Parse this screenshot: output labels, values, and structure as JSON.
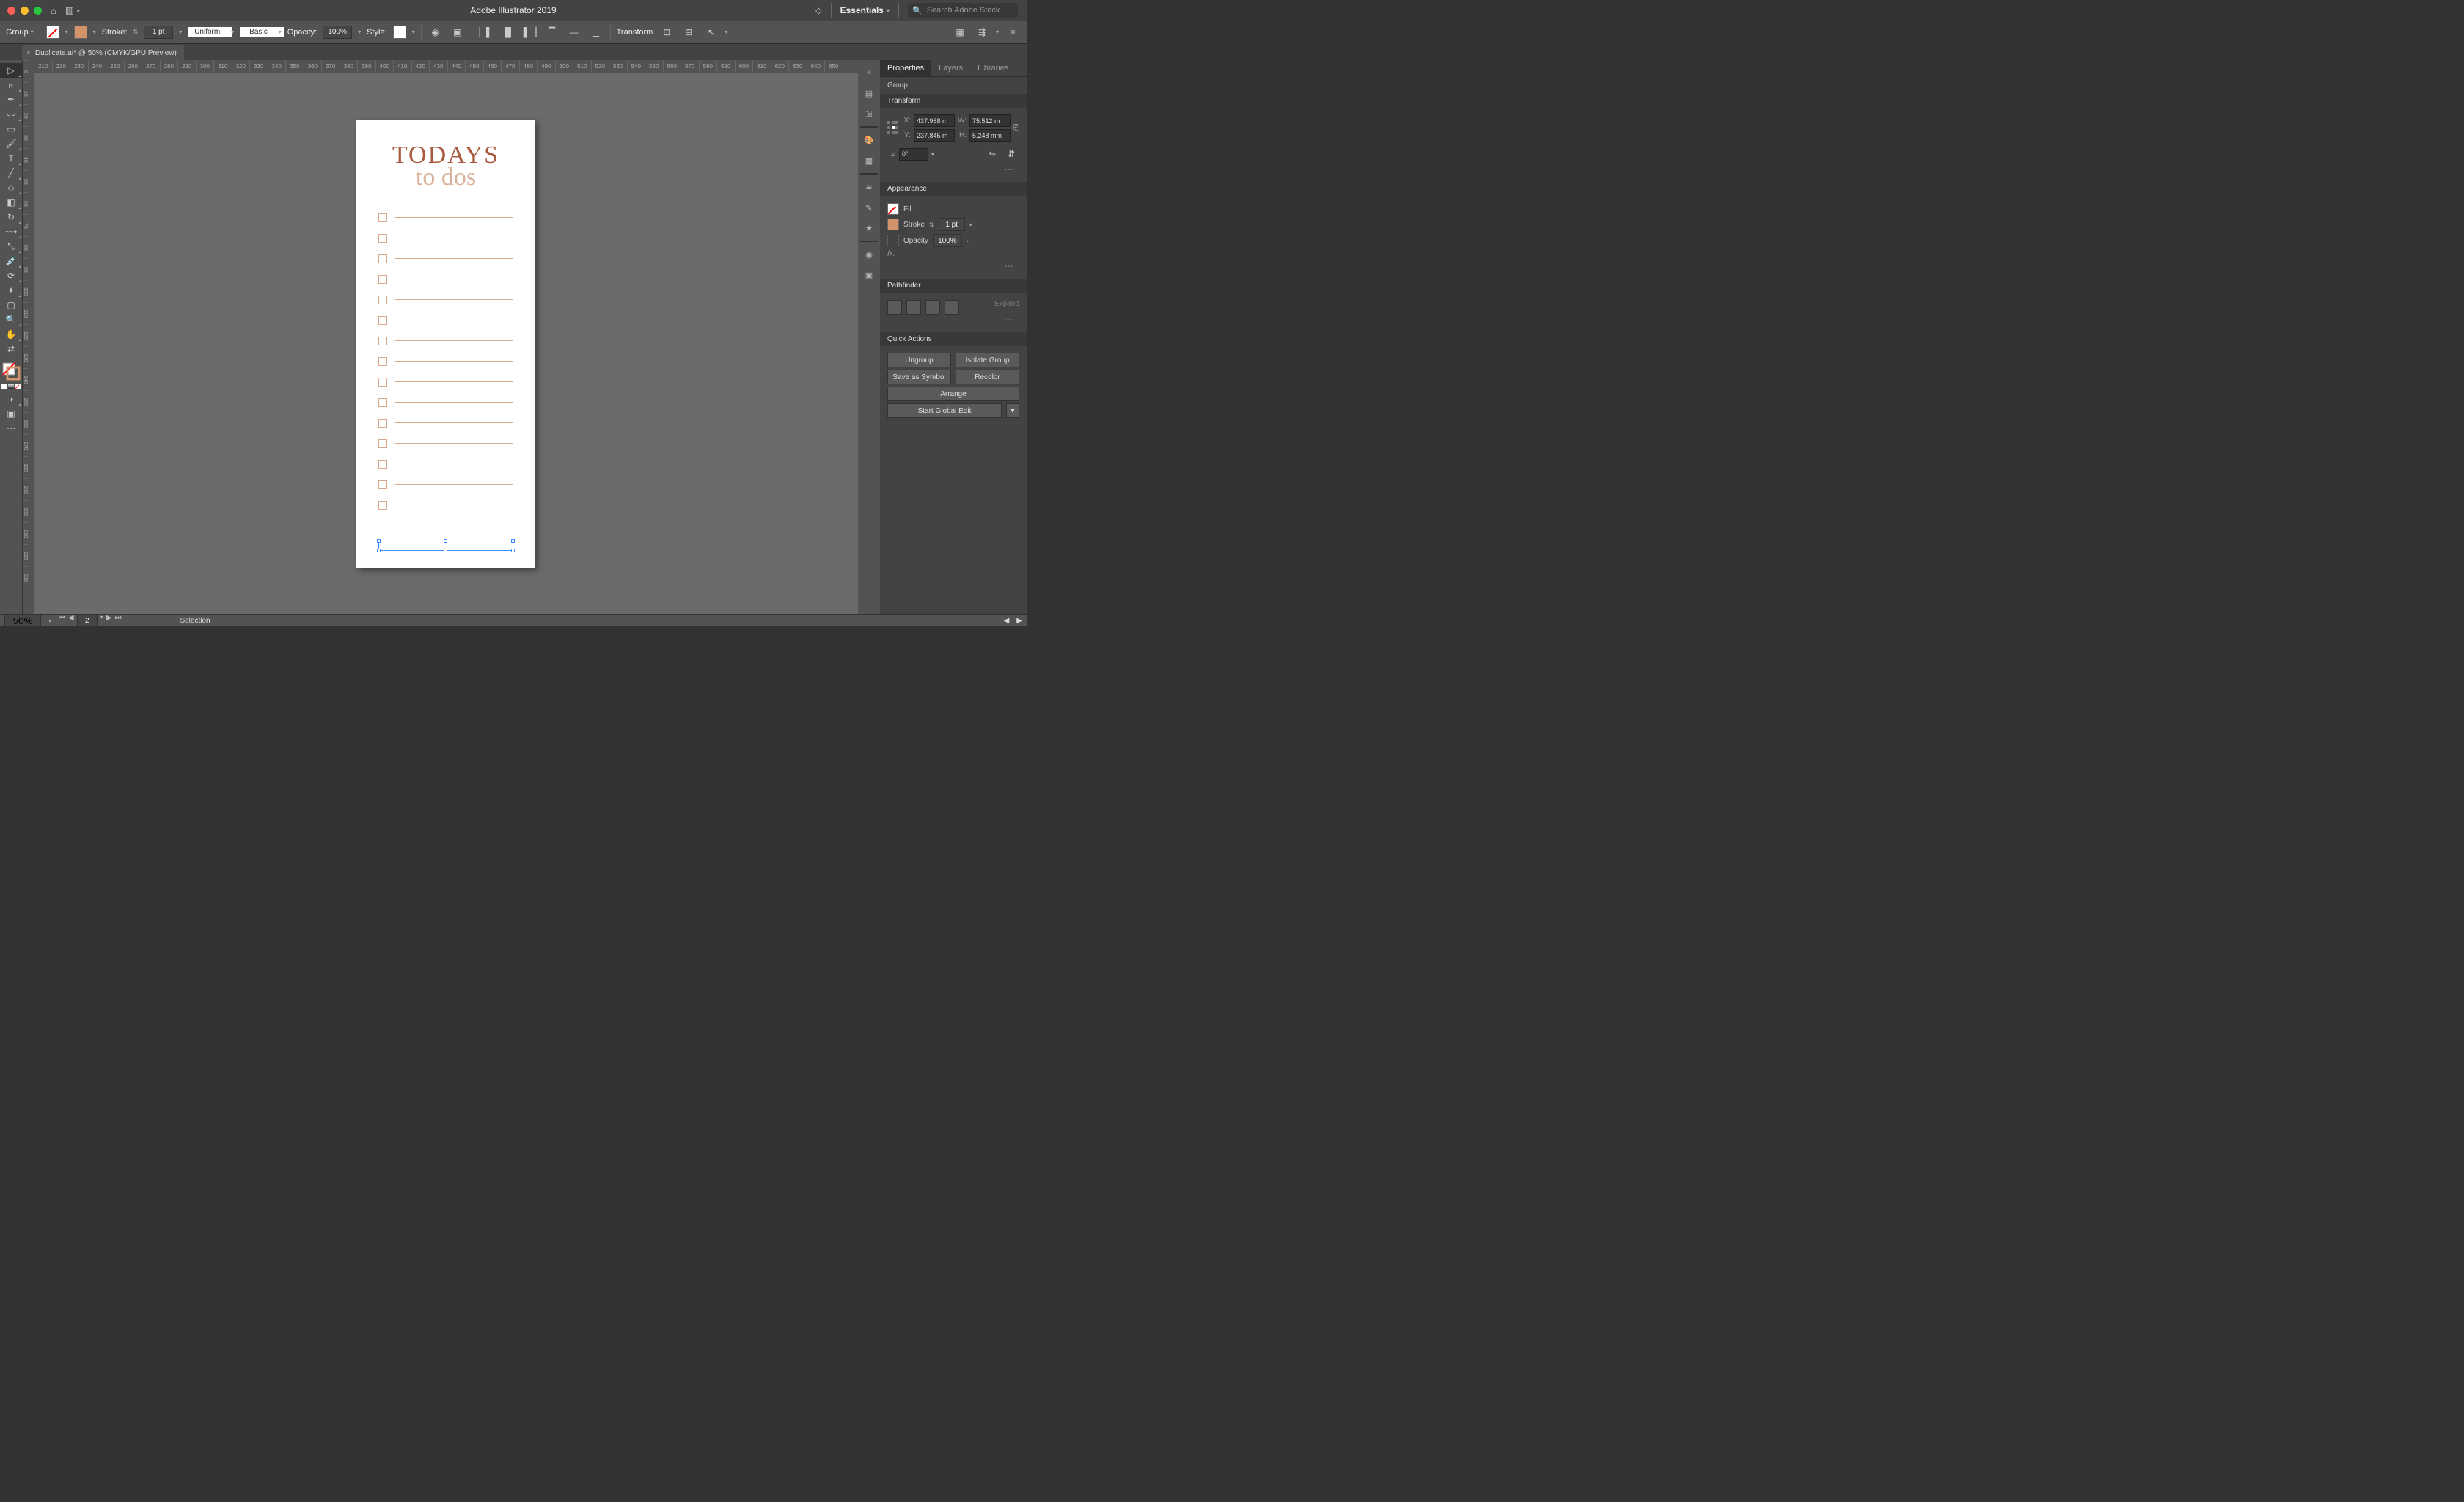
{
  "titlebar": {
    "title": "Adobe Illustrator 2019",
    "workspace": "Essentials",
    "stock_placeholder": "Search Adobe Stock"
  },
  "control": {
    "selection_label": "Group",
    "stroke_label": "Stroke:",
    "stroke_weight": "1 pt",
    "stroke_profile": "Uniform",
    "stroke_brush": "Basic",
    "opacity_label": "Opacity:",
    "opacity_value": "100%",
    "style_label": "Style:",
    "transform_label": "Transform"
  },
  "tab": {
    "name": "Duplicate.ai* @ 50% (CMYK/GPU Preview)"
  },
  "ruler_h": [
    "210",
    "220",
    "230",
    "240",
    "250",
    "260",
    "270",
    "280",
    "290",
    "300",
    "310",
    "320",
    "330",
    "340",
    "350",
    "360",
    "370",
    "380",
    "390",
    "400",
    "410",
    "420",
    "430",
    "440",
    "450",
    "460",
    "470",
    "480",
    "490",
    "500",
    "510",
    "520",
    "530",
    "540",
    "550",
    "560",
    "570",
    "580",
    "590",
    "600",
    "610",
    "620",
    "630",
    "640",
    "650"
  ],
  "ruler_v_sample": [
    "0",
    "10",
    "20",
    "30",
    "40",
    "50",
    "60",
    "70",
    "80",
    "90",
    "100",
    "110",
    "120",
    "130",
    "140",
    "150",
    "160",
    "170",
    "180",
    "190",
    "200",
    "210",
    "220",
    "230"
  ],
  "artboard": {
    "heading": "TODAYS",
    "script": "to dos",
    "todo_count": 15
  },
  "panel": {
    "tabs": [
      "Properties",
      "Layers",
      "Libraries"
    ],
    "active_tab": 0,
    "obj_type": "Group",
    "transform": {
      "title": "Transform",
      "x": "437.988 m",
      "y": "237.845 m",
      "w": "75.512 m",
      "h": "5.248 mm",
      "rotate": "0°"
    },
    "appearance": {
      "title": "Appearance",
      "fill_label": "Fill",
      "stroke_label": "Stroke",
      "stroke_val": "1 pt",
      "opacity_label": "Opacity",
      "opacity_val": "100%",
      "fx": "fx."
    },
    "pathfinder": {
      "title": "Pathfinder",
      "expand": "Expand"
    },
    "quick": {
      "title": "Quick Actions",
      "ungroup": "Ungroup",
      "isolate": "Isolate Group",
      "symbol": "Save as Symbol",
      "recolor": "Recolor",
      "arrange": "Arrange",
      "global": "Start Global Edit"
    }
  },
  "status": {
    "zoom": "50%",
    "artboard": "2",
    "mode": "Selection"
  }
}
